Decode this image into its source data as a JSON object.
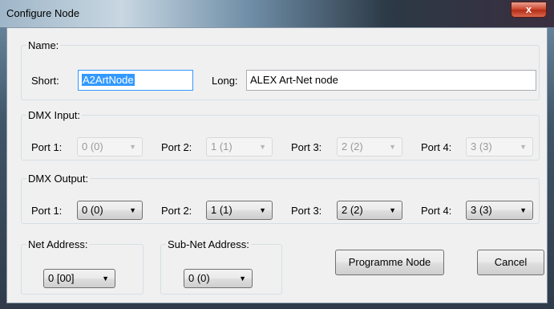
{
  "window": {
    "title": "Configure Node",
    "close_glyph": "x"
  },
  "name_group": {
    "legend": "Name:",
    "short_label": "Short:",
    "short_value": "A2ArtNode",
    "long_label": "Long:",
    "long_value": "ALEX Art-Net node"
  },
  "dmx_input": {
    "legend": "DMX Input:",
    "ports": [
      {
        "label": "Port 1:",
        "value": "0 (0)"
      },
      {
        "label": "Port 2:",
        "value": "1 (1)"
      },
      {
        "label": "Port 3:",
        "value": "2 (2)"
      },
      {
        "label": "Port 4:",
        "value": "3 (3)"
      }
    ]
  },
  "dmx_output": {
    "legend": "DMX Output:",
    "ports": [
      {
        "label": "Port 1:",
        "value": "0 (0)"
      },
      {
        "label": "Port 2:",
        "value": "1 (1)"
      },
      {
        "label": "Port 3:",
        "value": "2 (2)"
      },
      {
        "label": "Port 4:",
        "value": "3 (3)"
      }
    ]
  },
  "net_address": {
    "legend": "Net Address:",
    "value": "0 [00]"
  },
  "subnet_address": {
    "legend": "Sub-Net Address:",
    "value": "0 (0)"
  },
  "buttons": {
    "programme": "Programme Node",
    "cancel": "Cancel"
  },
  "icons": {
    "dropdown_arrow": "▼"
  }
}
